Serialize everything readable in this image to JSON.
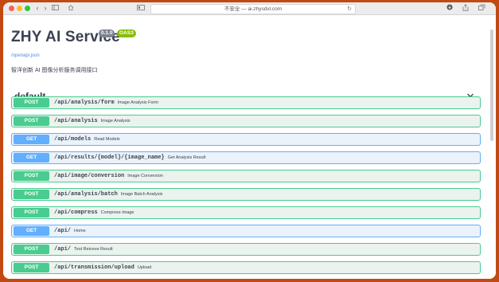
{
  "browser": {
    "url": "不安全 — ai.zhysdxl.com",
    "reload_icon": "reload-icon"
  },
  "api": {
    "title": "ZHY AI Service",
    "version": "0.1.0",
    "oas": "OAS3",
    "spec_link": "/openapi.json",
    "description": "智洋创新 AI 图像分析服务调用接口"
  },
  "section": {
    "title": "default",
    "toggle_icon": "chevron-down-icon"
  },
  "colors": {
    "post": "#49cc90",
    "get": "#61affe"
  },
  "operations": [
    {
      "method": "POST",
      "path": "/api/analysis/form",
      "summary": "Image Analysis Form"
    },
    {
      "method": "POST",
      "path": "/api/analysis",
      "summary": "Image Analysis"
    },
    {
      "method": "GET",
      "path": "/api/models",
      "summary": "Read Models"
    },
    {
      "method": "GET",
      "path": "/api/results/{model}/{image_name}",
      "summary": "Get Analysis Result"
    },
    {
      "method": "POST",
      "path": "/api/image/conversion",
      "summary": "Image Conversion"
    },
    {
      "method": "POST",
      "path": "/api/analysis/batch",
      "summary": "Image Batch Analysis"
    },
    {
      "method": "POST",
      "path": "/api/compress",
      "summary": "Compress Image"
    },
    {
      "method": "GET",
      "path": "/api/",
      "summary": "Home"
    },
    {
      "method": "POST",
      "path": "/api/",
      "summary": "Test Reiceve Result"
    },
    {
      "method": "POST",
      "path": "/api/transmission/upload",
      "summary": "Upload"
    }
  ]
}
